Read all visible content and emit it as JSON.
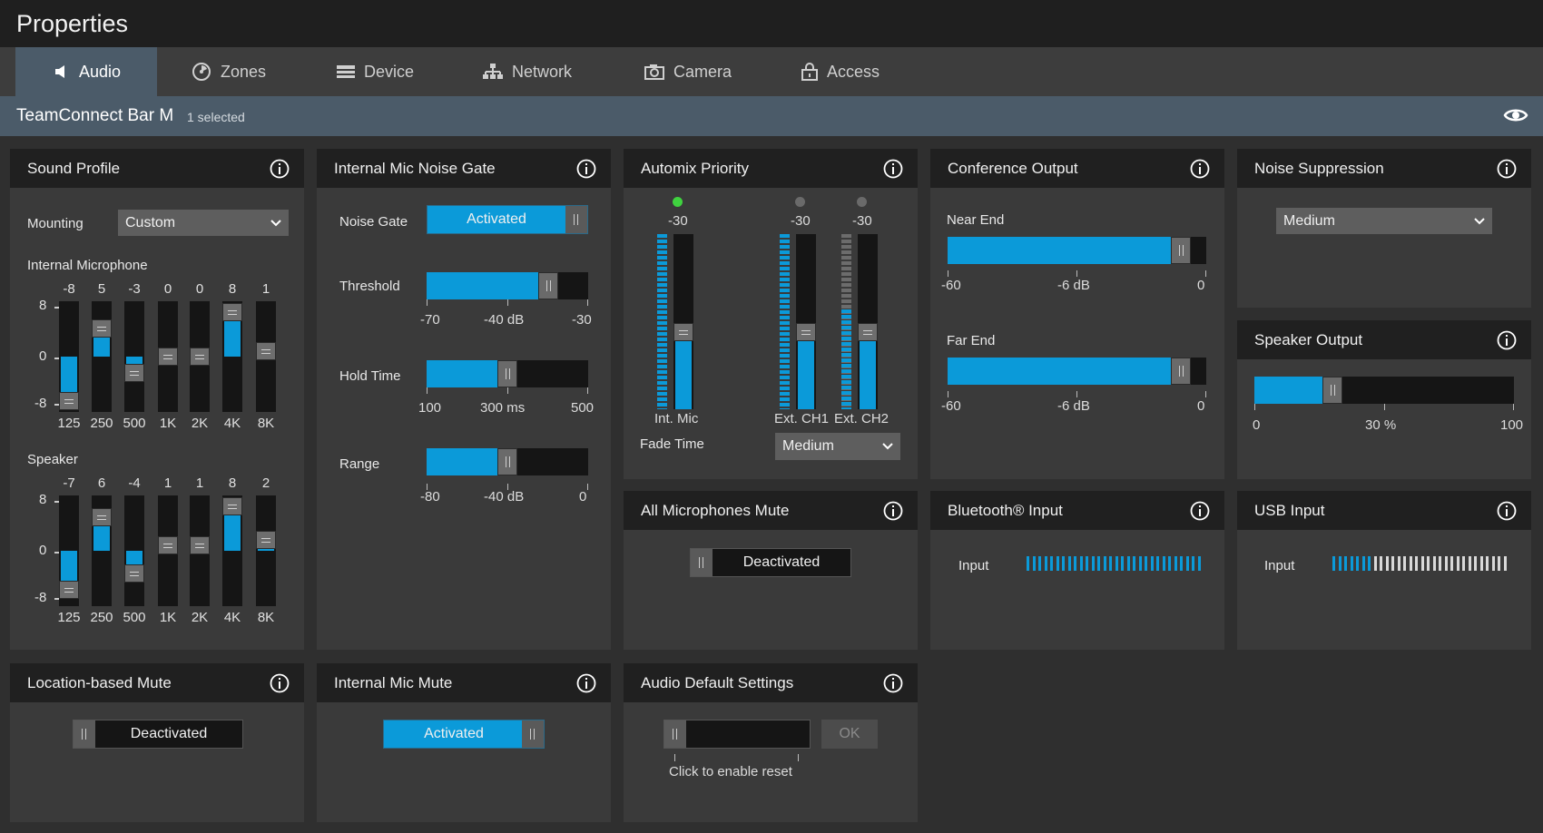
{
  "window": {
    "title": "Properties"
  },
  "tabs": [
    {
      "label": "Audio",
      "icon": "speaker-icon",
      "active": true
    },
    {
      "label": "Zones",
      "icon": "zones-icon"
    },
    {
      "label": "Device",
      "icon": "device-icon"
    },
    {
      "label": "Network",
      "icon": "network-icon"
    },
    {
      "label": "Camera",
      "icon": "camera-icon"
    },
    {
      "label": "Access",
      "icon": "lock-icon"
    }
  ],
  "device": {
    "name": "TeamConnect Bar M",
    "selection": "1 selected"
  },
  "colors": {
    "accent": "#0b9ad9",
    "panel": "#3a3a3a",
    "header": "#202020",
    "device_bar": "#4b5b69",
    "active_led": "#3fd23f"
  },
  "sound_profile": {
    "title": "Sound Profile",
    "mounting_label": "Mounting",
    "mounting_value": "Custom",
    "scale": {
      "top": "8",
      "mid": "0",
      "bottom": "-8"
    },
    "internal_microphone": {
      "label": "Internal Microphone",
      "bands": [
        {
          "freq": "125",
          "gain": "-8"
        },
        {
          "freq": "250",
          "gain": "5"
        },
        {
          "freq": "500",
          "gain": "-3"
        },
        {
          "freq": "1K",
          "gain": "0"
        },
        {
          "freq": "2K",
          "gain": "0"
        },
        {
          "freq": "4K",
          "gain": "8"
        },
        {
          "freq": "8K",
          "gain": "1"
        }
      ]
    },
    "speaker": {
      "label": "Speaker",
      "bands": [
        {
          "freq": "125",
          "gain": "-7"
        },
        {
          "freq": "250",
          "gain": "6"
        },
        {
          "freq": "500",
          "gain": "-4"
        },
        {
          "freq": "1K",
          "gain": "1"
        },
        {
          "freq": "2K",
          "gain": "1"
        },
        {
          "freq": "4K",
          "gain": "8"
        },
        {
          "freq": "8K",
          "gain": "2"
        }
      ]
    }
  },
  "noise_gate": {
    "title": "Internal Mic Noise Gate",
    "gate_label": "Noise Gate",
    "gate_state": "Activated",
    "threshold": {
      "label": "Threshold",
      "min": "-70",
      "max": "-30",
      "value": "-40 dB",
      "fraction": 0.75
    },
    "hold_time": {
      "label": "Hold Time",
      "min": "100",
      "max": "500",
      "value": "300 ms",
      "fraction": 0.5
    },
    "range": {
      "label": "Range",
      "min": "-80",
      "max": "0",
      "value": "-40 dB",
      "fraction": 0.5
    }
  },
  "automix": {
    "title": "Automix Priority",
    "channels": [
      {
        "name": "Int. Mic",
        "level": "-30",
        "active": true
      },
      {
        "name": "Ext. CH1",
        "level": "-30",
        "active": false
      },
      {
        "name": "Ext. CH2",
        "level": "-30",
        "active": false
      }
    ],
    "fade_label": "Fade Time",
    "fade_value": "Medium"
  },
  "conference_output": {
    "title": "Conference Output",
    "near": {
      "label": "Near End",
      "min": "-60",
      "max": "0",
      "value": "-6 dB",
      "fraction": 0.9
    },
    "far": {
      "label": "Far End",
      "min": "-60",
      "max": "0",
      "value": "-6 dB",
      "fraction": 0.9
    }
  },
  "noise_suppression": {
    "title": "Noise Suppression",
    "value": "Medium"
  },
  "speaker_output": {
    "title": "Speaker Output",
    "min": "0",
    "max": "100",
    "value": "30 %",
    "fraction": 0.3
  },
  "all_mics_mute": {
    "title": "All Microphones Mute",
    "state": "Deactivated"
  },
  "bluetooth_input": {
    "title": "Bluetooth® Input",
    "label": "Input",
    "level_fraction": 1.0
  },
  "usb_input": {
    "title": "USB Input",
    "label": "Input",
    "level_fraction": 0.22
  },
  "location_mute": {
    "title": "Location-based Mute",
    "state": "Deactivated"
  },
  "internal_mic_mute": {
    "title": "Internal Mic Mute",
    "state": "Activated"
  },
  "audio_default": {
    "title": "Audio Default Settings",
    "ok_label": "OK",
    "hint": "Click to enable reset"
  }
}
